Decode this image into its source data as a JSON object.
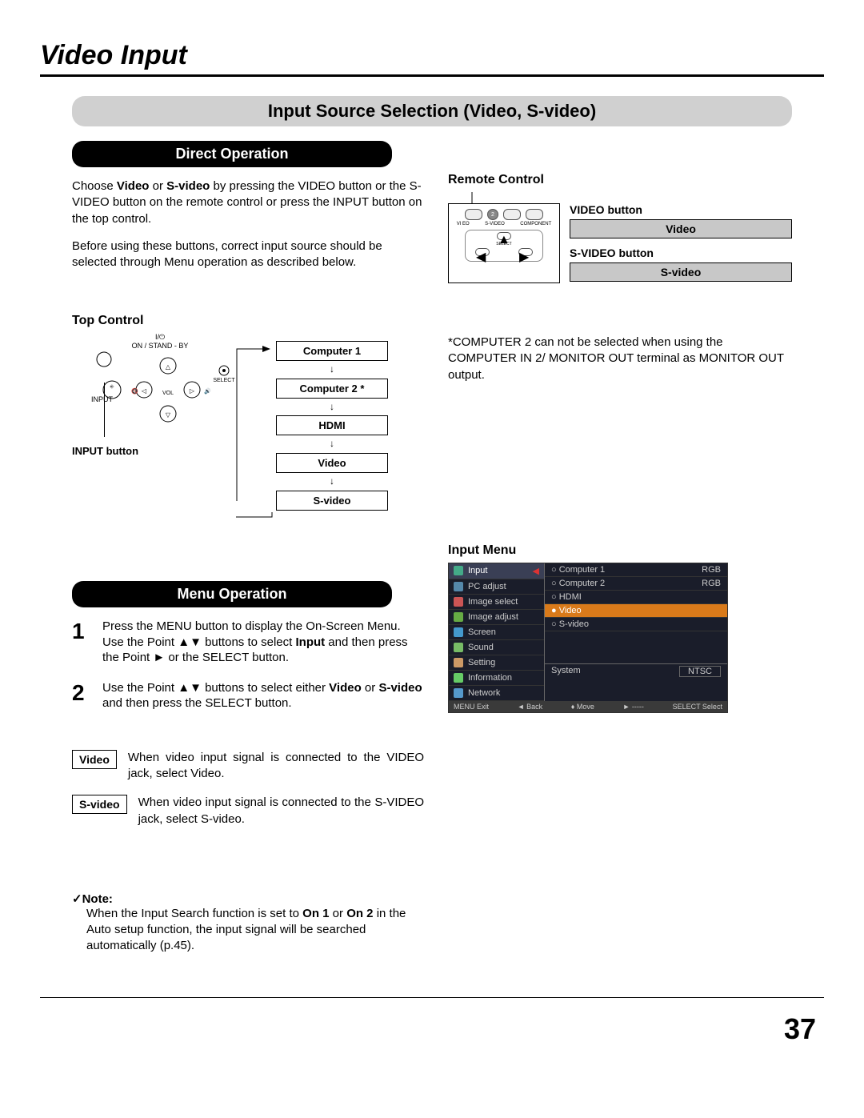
{
  "page_title": "Video Input",
  "section_header": "Input Source Selection (Video, S-video)",
  "direct_operation": {
    "heading": "Direct Operation",
    "para1_a": "Choose ",
    "para1_b": "Video",
    "para1_c": " or ",
    "para1_d": "S-video",
    "para1_e": " by pressing the VIDEO button or the S-VIDEO button on the remote control or press the INPUT button on the top control.",
    "para2": "Before using these buttons, correct input source should be selected through Menu operation as described below."
  },
  "remote": {
    "heading": "Remote Control",
    "video_button_label": "VIDEO button",
    "video_box": "Video",
    "svideo_button_label": "S-VIDEO button",
    "svideo_box": "S-video",
    "small_labels": {
      "video": "VI EO",
      "svideo": "S-VIDEO",
      "component": "COMPONENT",
      "select": "SELECT",
      "two": "2"
    }
  },
  "top_control": {
    "heading": "Top Control",
    "standby": "ON / STAND - BY",
    "input_label": "INPUT",
    "vol_label": "VOL",
    "select_label": "SELECT",
    "input_button": "INPUT button",
    "cycle": [
      "Computer 1",
      "Computer 2 *",
      "HDMI",
      "Video",
      "S-video"
    ]
  },
  "c2_note": {
    "star": "*",
    "text": "COMPUTER 2 can not be selected when using the COMPUTER IN 2/ MONITOR OUT terminal as MONITOR OUT output."
  },
  "menu_operation": {
    "heading": "Menu Operation",
    "step1_a": "Press the MENU button to display the On-Screen Menu. Use the Point ▲▼ buttons to select ",
    "step1_b": "Input",
    "step1_c": " and then press the Point ► or the SELECT button.",
    "step2_a": "Use the Point ▲▼ buttons to select either ",
    "step2_b": "Video",
    "step2_c": " or ",
    "step2_d": "S-video",
    "step2_e": " and then press the SELECT button.",
    "step1_num": "1",
    "step2_num": "2"
  },
  "video_desc": {
    "label": "Video",
    "text": "When video input signal is connected to the VIDEO jack, select Video."
  },
  "svideo_desc": {
    "label": "S-video",
    "text": "When video input signal is connected to the S-VIDEO jack, select S-video."
  },
  "input_menu": {
    "heading": "Input Menu",
    "left_items": [
      "Input",
      "PC adjust",
      "Image select",
      "Image adjust",
      "Screen",
      "Sound",
      "Setting",
      "Information",
      "Network"
    ],
    "right_items": [
      {
        "label": "Computer 1",
        "val": "RGB"
      },
      {
        "label": "Computer 2",
        "val": "RGB"
      },
      {
        "label": "HDMI",
        "val": ""
      },
      {
        "label": "Video",
        "val": ""
      },
      {
        "label": "S-video",
        "val": ""
      }
    ],
    "highlighted": "Video",
    "system_label": "System",
    "system_val": "NTSC",
    "footer": {
      "exit": "MENU Exit",
      "back": "◄ Back",
      "move": "♦ Move",
      "next": "► -----",
      "select": "SELECT Select"
    }
  },
  "note": {
    "heading": "Note:",
    "text_a": "When the Input Search function is set to ",
    "text_b": "On 1",
    "text_c": " or ",
    "text_d": "On 2",
    "text_e": " in the Auto setup function, the input signal will be searched automatically (p.45)."
  },
  "page_number": "37"
}
